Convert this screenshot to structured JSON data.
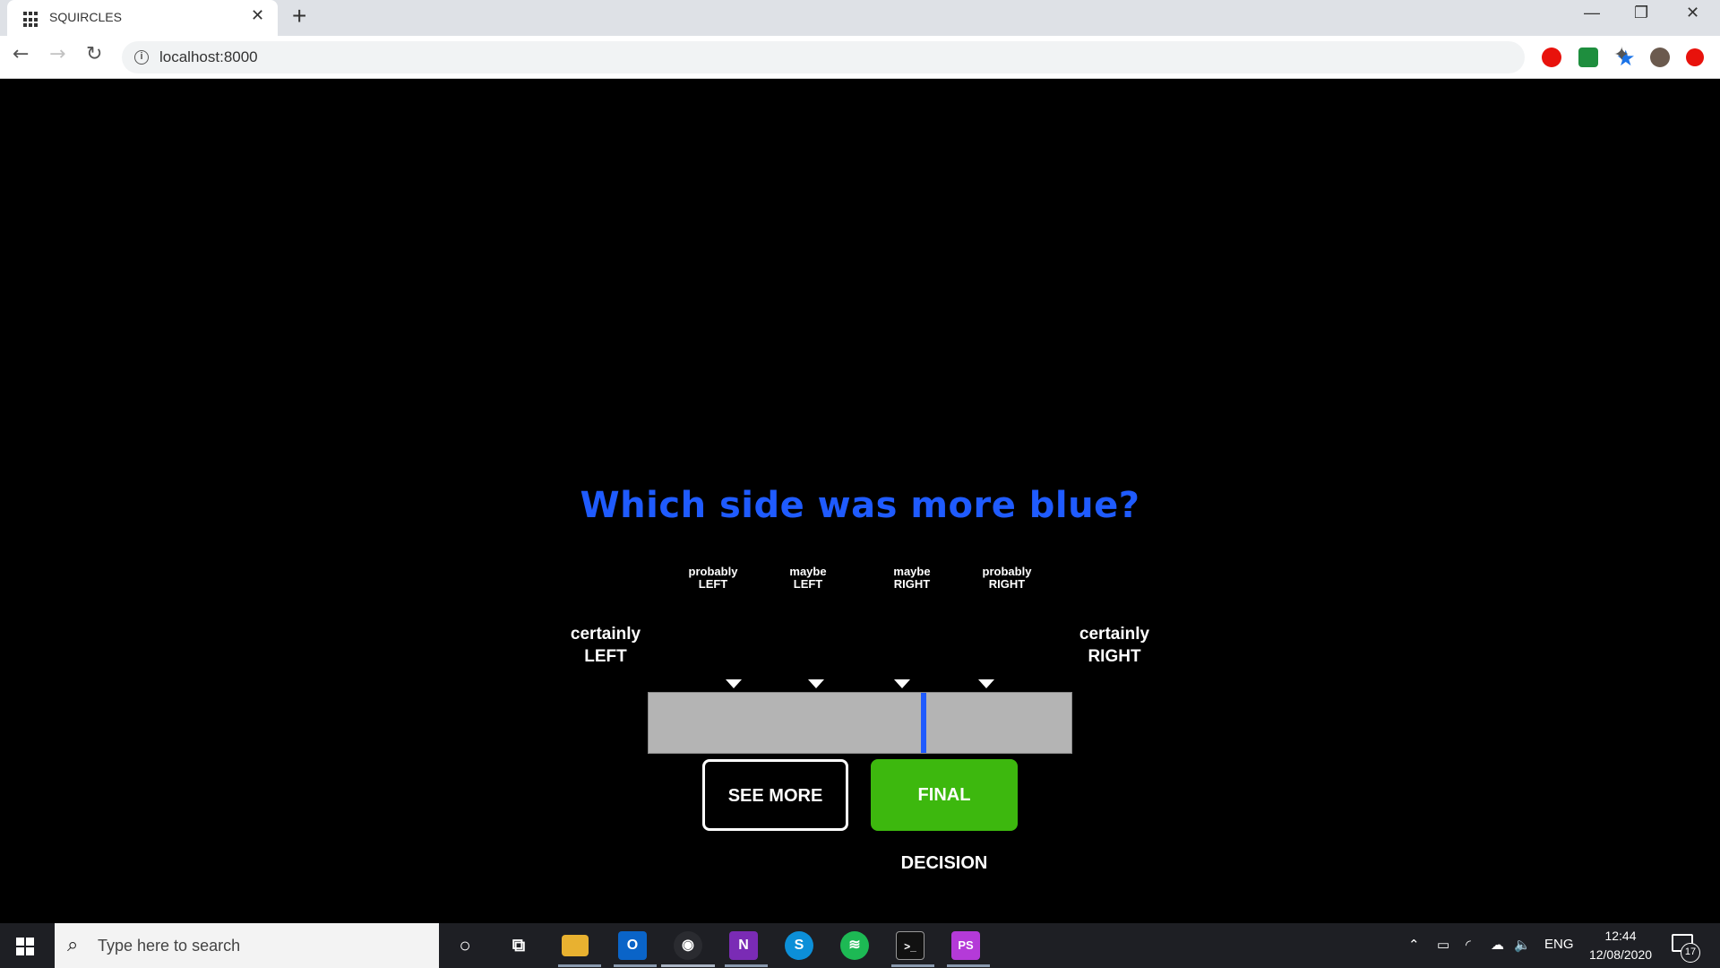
{
  "browser": {
    "tab_title": "SQUIRCLES",
    "tab_close": "✕",
    "new_tab": "+",
    "url": "localhost:8000",
    "window_controls": {
      "minimize": "—",
      "restore": "❐",
      "close": "✕"
    }
  },
  "task": {
    "question": "Which side was more blue?",
    "end_left": {
      "line1": "certainly",
      "line2": "LEFT"
    },
    "end_right": {
      "line1": "certainly",
      "line2": "RIGHT"
    },
    "markers": [
      {
        "line1": "probably",
        "line2": "LEFT"
      },
      {
        "line1": "maybe",
        "line2": "LEFT"
      },
      {
        "line1": "maybe",
        "line2": "RIGHT"
      },
      {
        "line1": "probably",
        "line2": "RIGHT"
      }
    ],
    "slider_value": 0.65,
    "buttons": {
      "see_more": "SEE MORE",
      "final_decision": "FINAL DECISION"
    },
    "colors": {
      "question": "#1f5bff",
      "slider_track": "#b4b4b4",
      "slider_thumb": "#1f5bff",
      "final_button": "#3db80e"
    }
  },
  "taskbar": {
    "search_placeholder": "Type here to search",
    "apps": [
      "cortana-icon",
      "task-view-icon",
      "file-explorer-icon",
      "outlook-icon",
      "chrome-icon",
      "onenote-icon",
      "skype-icon",
      "spotify-icon",
      "terminal-icon",
      "phpstorm-icon"
    ],
    "language": "ENG",
    "time": "12:44",
    "date": "12/08/2020",
    "notification_count": "17"
  }
}
